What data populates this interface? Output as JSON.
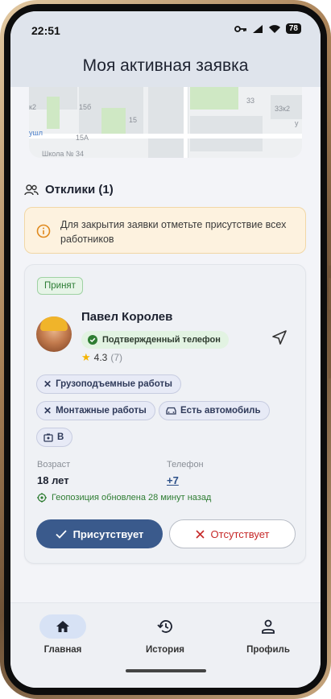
{
  "status_bar": {
    "time": "22:51",
    "battery": "78"
  },
  "page_title": "Моя активная заявка",
  "map": {
    "labels": [
      "к2",
      "15б",
      "15",
      "15А",
      "ушл",
      "Школа № 34",
      "33",
      "33к2",
      "у"
    ]
  },
  "responses": {
    "title": "Отклики (1)"
  },
  "alert": {
    "text": "Для закрытия заявки отметьте присутствие всех работников"
  },
  "worker": {
    "status": "Принят",
    "name": "Павел Королев",
    "verified_label": "Подтвержденный телефон",
    "rating": "4.3",
    "rating_count": "(7)",
    "skills": [
      "Грузоподъемные работы",
      "Монтажные работы",
      "Есть автомобиль",
      "В"
    ],
    "age_label": "Возраст",
    "age_value": "18 лет",
    "phone_label": "Телефон",
    "phone_value": "+7",
    "geo_text": "Геопозиция обновлена 28 минут назад",
    "present_label": "Присутствует",
    "absent_label": "Отсутствует"
  },
  "bottom_nav": [
    {
      "label": "Главная",
      "icon": "home-icon",
      "active": true
    },
    {
      "label": "История",
      "icon": "history-icon",
      "active": false
    },
    {
      "label": "Профиль",
      "icon": "profile-icon",
      "active": false
    }
  ],
  "colors": {
    "primary": "#3a5a8c",
    "success": "#2e7d32",
    "danger": "#c62828",
    "warning_bg": "#fdf2df"
  }
}
